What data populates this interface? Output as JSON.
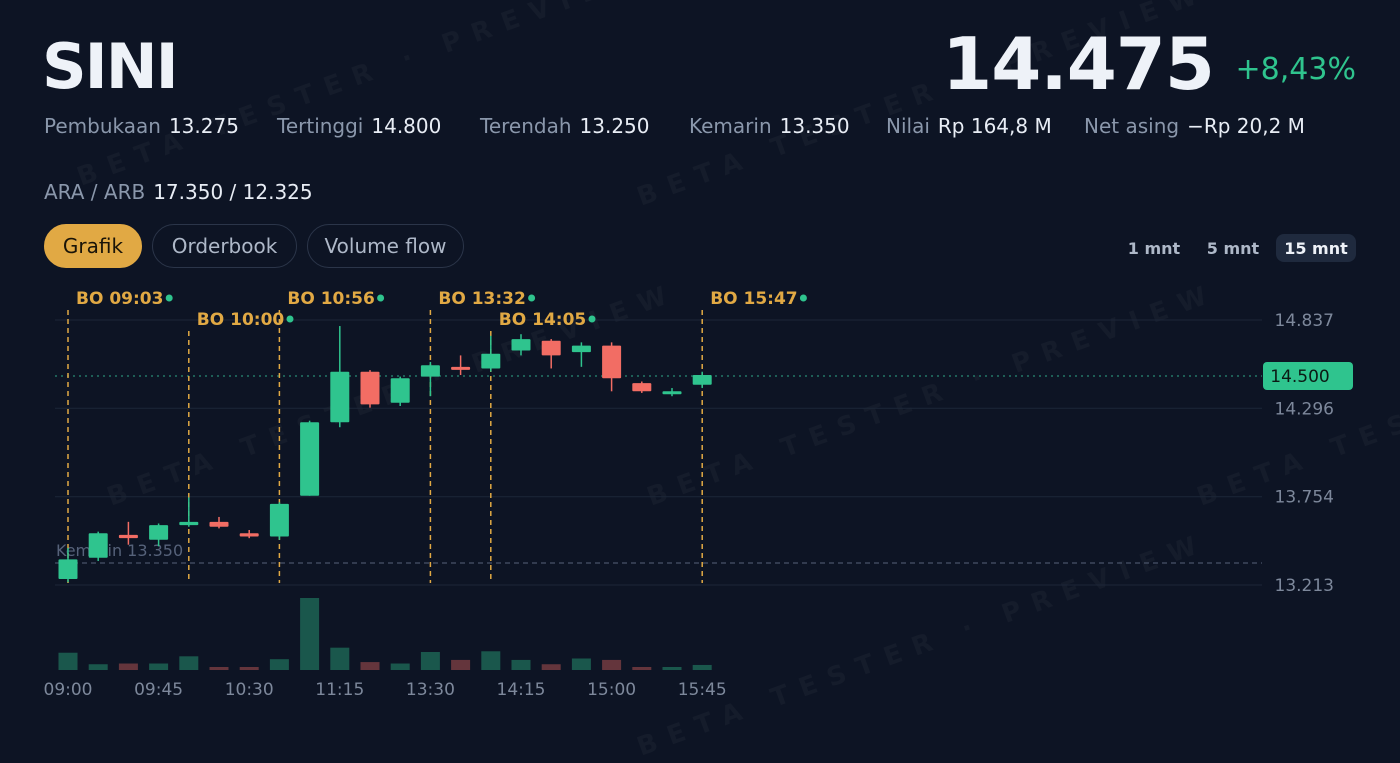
{
  "header": {
    "ticker": "SINI",
    "price": "14.475",
    "change": "+8,43%"
  },
  "stats": [
    {
      "label": "Pembukaan",
      "value": "13.275"
    },
    {
      "label": "Tertinggi",
      "value": "14.800"
    },
    {
      "label": "Terendah",
      "value": "13.250"
    },
    {
      "label": "Kemarin",
      "value": "13.350"
    },
    {
      "label": "Nilai",
      "value": "Rp 164,8 M"
    },
    {
      "label": "Net asing",
      "value": "−Rp 20,2 M"
    }
  ],
  "ara_arb": {
    "label": "ARA / ARB",
    "value": "17.350 / 12.325"
  },
  "tabs": [
    "Grafik",
    "Orderbook",
    "Volume flow"
  ],
  "active_tab": "Grafik",
  "timeframes": [
    "1 mnt",
    "5 mnt",
    "15 mnt"
  ],
  "active_timeframe": "15 mnt",
  "watermark": "BETA TESTER · PREVIEW",
  "colors": {
    "up": "#2fc48e",
    "down": "#f26d64",
    "accent": "#e1a944",
    "background": "#0d1424"
  },
  "chart_data": {
    "type": "candlestick",
    "y_ticks": [
      "14.837",
      "14.296",
      "13.754",
      "13.213"
    ],
    "y_tick_values": [
      14837,
      14296,
      13754,
      13213
    ],
    "x_tick_labels": [
      "09:00",
      "09:45",
      "10:30",
      "11:15",
      "13:30",
      "14:15",
      "15:00",
      "15:45"
    ],
    "current_price_label": "14.500",
    "current_price": 14500,
    "previous_close_label": "Kemarin 13.350",
    "previous_close": 13350,
    "candles": [
      {
        "o": 13250,
        "c": 13370,
        "h": 13440,
        "l": 13230,
        "v": 0.24
      },
      {
        "o": 13380,
        "c": 13530,
        "h": 13540,
        "l": 13360,
        "v": 0.08
      },
      {
        "o": 13520,
        "c": 13500,
        "h": 13600,
        "l": 13460,
        "v": 0.09
      },
      {
        "o": 13490,
        "c": 13580,
        "h": 13590,
        "l": 13450,
        "v": 0.09
      },
      {
        "o": 13580,
        "c": 13600,
        "h": 13750,
        "l": 13570,
        "v": 0.19
      },
      {
        "o": 13600,
        "c": 13570,
        "h": 13630,
        "l": 13560,
        "v": 0.03
      },
      {
        "o": 13530,
        "c": 13510,
        "h": 13550,
        "l": 13500,
        "v": 0.03
      },
      {
        "o": 13510,
        "c": 13710,
        "h": 13720,
        "l": 13490,
        "v": 0.15
      },
      {
        "o": 13760,
        "c": 14210,
        "h": 14220,
        "l": 13760,
        "v": 1.0
      },
      {
        "o": 14210,
        "c": 14520,
        "h": 14800,
        "l": 14180,
        "v": 0.31
      },
      {
        "o": 14520,
        "c": 14320,
        "h": 14530,
        "l": 14300,
        "v": 0.11
      },
      {
        "o": 14330,
        "c": 14480,
        "h": 14490,
        "l": 14310,
        "v": 0.09
      },
      {
        "o": 14490,
        "c": 14560,
        "h": 14580,
        "l": 14370,
        "v": 0.25
      },
      {
        "o": 14550,
        "c": 14540,
        "h": 14620,
        "l": 14500,
        "v": 0.14
      },
      {
        "o": 14540,
        "c": 14630,
        "h": 14740,
        "l": 14520,
        "v": 0.26
      },
      {
        "o": 14650,
        "c": 14720,
        "h": 14750,
        "l": 14620,
        "v": 0.14
      },
      {
        "o": 14710,
        "c": 14620,
        "h": 14720,
        "l": 14540,
        "v": 0.08
      },
      {
        "o": 14640,
        "c": 14680,
        "h": 14700,
        "l": 14550,
        "v": 0.16
      },
      {
        "o": 14680,
        "c": 14480,
        "h": 14700,
        "l": 14400,
        "v": 0.14
      },
      {
        "o": 14450,
        "c": 14400,
        "h": 14460,
        "l": 14390,
        "v": 0.03
      },
      {
        "o": 14390,
        "c": 14400,
        "h": 14420,
        "l": 14370,
        "v": 0.04
      },
      {
        "o": 14440,
        "c": 14500,
        "h": 14520,
        "l": 14420,
        "v": 0.07
      }
    ],
    "breakouts": [
      {
        "label": "BO 09:03",
        "index": 0,
        "row": 0
      },
      {
        "label": "BO 10:00",
        "index": 4,
        "row": 1
      },
      {
        "label": "BO 10:56",
        "index": 7,
        "row": 0
      },
      {
        "label": "BO 13:32",
        "index": 12,
        "row": 0
      },
      {
        "label": "BO 14:05",
        "index": 14,
        "row": 1
      },
      {
        "label": "BO 15:47",
        "index": 21,
        "row": 0
      }
    ]
  }
}
